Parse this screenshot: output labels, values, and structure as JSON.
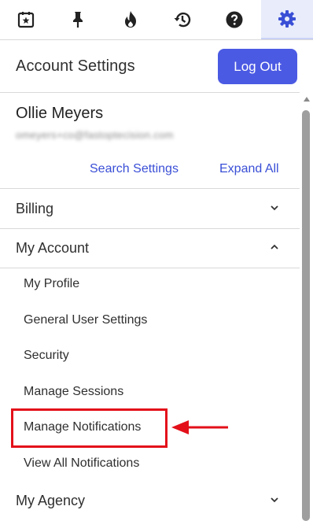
{
  "toolbar": {
    "icons": [
      "calendar-star-icon",
      "pin-icon",
      "flame-icon",
      "history-icon",
      "help-icon",
      "gear-icon"
    ],
    "active_tab": "settings"
  },
  "header": {
    "title": "Account Settings",
    "logout_label": "Log Out"
  },
  "user": {
    "name": "Ollie Meyers",
    "email": "omeyers+co@fastoptecision.com"
  },
  "links": {
    "search_settings": "Search Settings",
    "expand_all": "Expand All"
  },
  "sections": {
    "billing": "Billing",
    "my_account": "My Account",
    "my_agency": "My Agency"
  },
  "my_account_items": [
    "My Profile",
    "General User Settings",
    "Security",
    "Manage Sessions",
    "Manage Notifications",
    "View All Notifications"
  ],
  "colors": {
    "accent": "#4b5ae3",
    "link": "#3a4fd6",
    "highlight": "#e3101a",
    "active_tab_bg": "#e8ecfb"
  }
}
